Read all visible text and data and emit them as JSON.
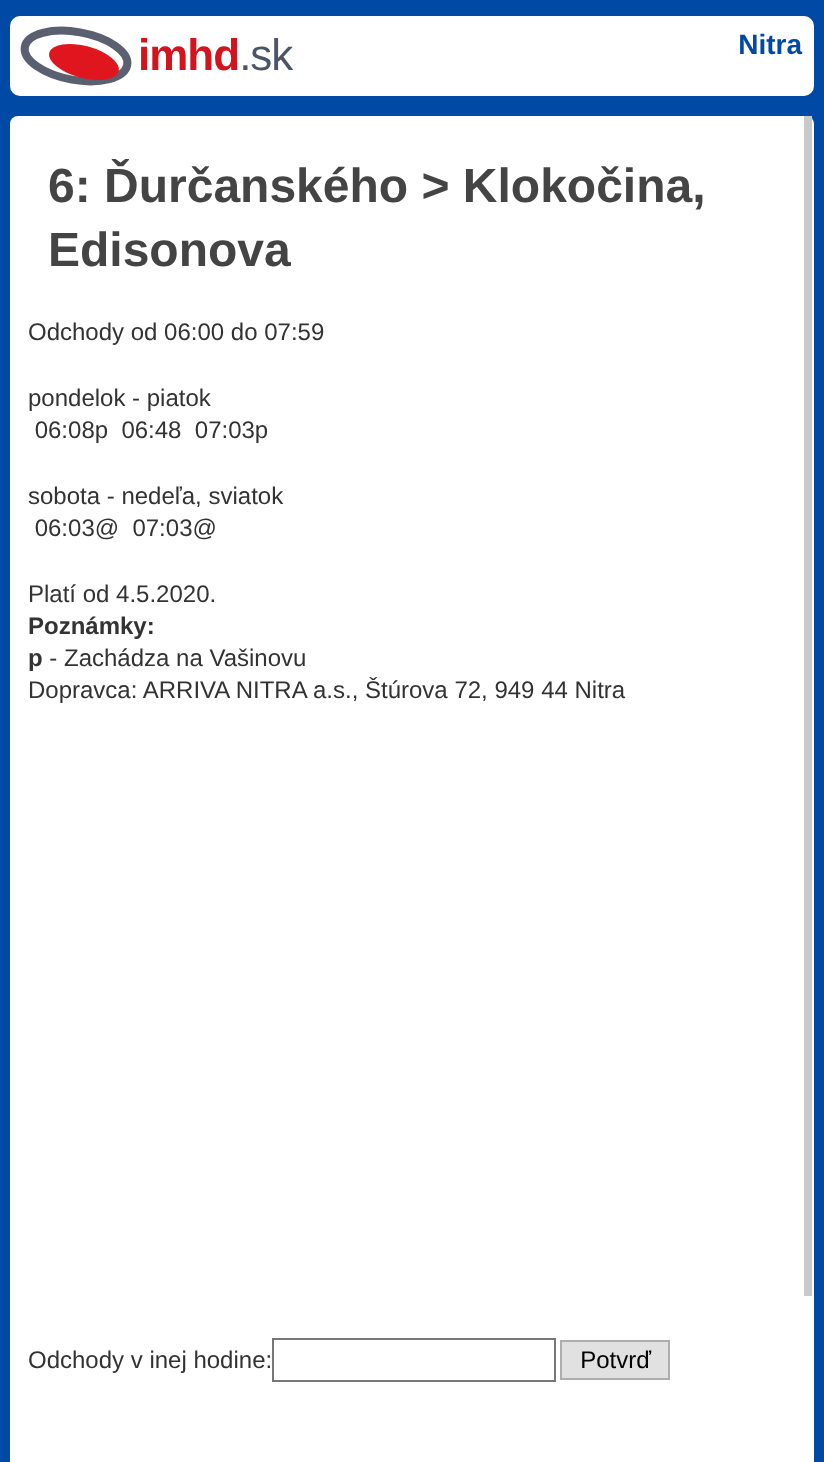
{
  "header": {
    "logo_main": "imhd",
    "logo_suffix": ".sk",
    "city": "Nitra"
  },
  "title": "6: Ďurčanského > Klokočina, Edisonova",
  "range": "Odchody od 06:00 do 07:59",
  "schedules": [
    {
      "days": "pondelok - piatok",
      "times": " 06:08p  06:48  07:03p"
    },
    {
      "days": "sobota - nedeľa, sviatok",
      "times": " 06:03@  07:03@"
    }
  ],
  "valid_from": "Platí od 4.5.2020.",
  "notes_heading": "Poznámky:",
  "notes": [
    "**p** - Zachádza na Vašinovu"
  ],
  "operator": "Dopravca: ARRIVA NITRA a.s., Štúrova 72, 949 44 Nitra",
  "form": {
    "label": "Odchody v inej hodine:",
    "button": "Potvrď"
  }
}
